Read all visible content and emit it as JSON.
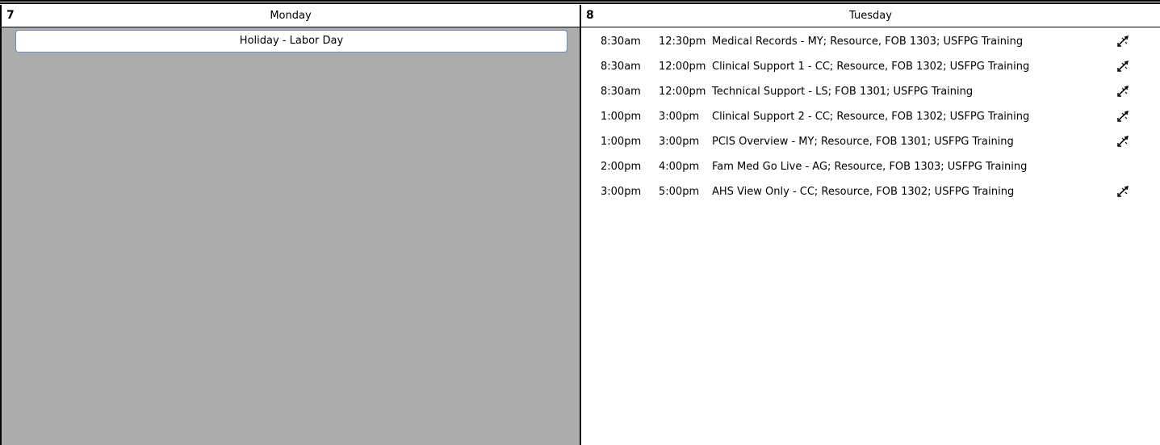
{
  "monday": {
    "number": "7",
    "name": "Monday",
    "holiday": "Holiday - Labor Day"
  },
  "tuesday": {
    "number": "8",
    "name": "Tuesday",
    "events": [
      {
        "start": "8:30am",
        "end": "12:30pm",
        "title": "Medical Records - MY; Resource, FOB 1303; USFPG Training",
        "icon": "recurring-link-icon"
      },
      {
        "start": "8:30am",
        "end": "12:00pm",
        "title": "Clinical Support 1 - CC; Resource, FOB 1302; USFPG Training",
        "icon": "recurring-link-icon"
      },
      {
        "start": "8:30am",
        "end": "12:00pm",
        "title": "Technical Support - LS; FOB 1301; USFPG Training",
        "icon": "recurring-link-icon"
      },
      {
        "start": "1:00pm",
        "end": "3:00pm",
        "title": "Clinical Support 2 - CC; Resource, FOB 1302; USFPG Training",
        "icon": "recurring-link-icon"
      },
      {
        "start": "1:00pm",
        "end": "3:00pm",
        "title": "PCIS Overview - MY; Resource, FOB 1301; USFPG Training",
        "icon": "recurring-link-icon"
      },
      {
        "start": "2:00pm",
        "end": "4:00pm",
        "title": "Fam Med Go Live - AG; Resource, FOB 1303; USFPG Training",
        "icon": ""
      },
      {
        "start": "3:00pm",
        "end": "5:00pm",
        "title": "AHS View Only - CC; Resource, FOB 1302; USFPG Training",
        "icon": "recurring-link-icon"
      }
    ]
  },
  "colors": {
    "holiday_background": "#acacac",
    "holiday_border": "#6f8fb6"
  }
}
